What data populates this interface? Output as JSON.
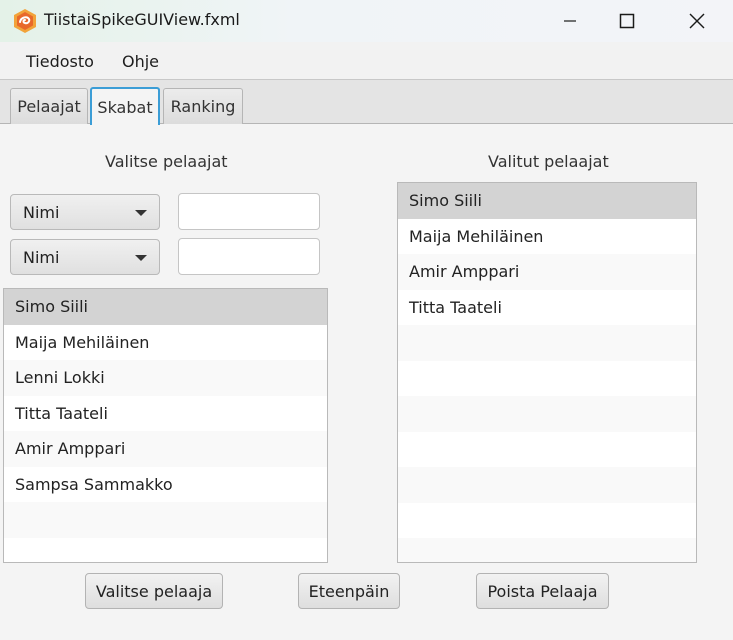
{
  "window": {
    "title": "TiistaiSpikeGUIView.fxml"
  },
  "menu": {
    "items": [
      "Tiedosto",
      "Ohje"
    ]
  },
  "tabs": [
    {
      "label": "Pelaajat",
      "active": false
    },
    {
      "label": "Skabat",
      "active": true
    },
    {
      "label": "Ranking",
      "active": false
    }
  ],
  "left_panel": {
    "title": "Valitse pelaajat",
    "filters": [
      {
        "combo_value": "Nimi",
        "text_value": ""
      },
      {
        "combo_value": "Nimi",
        "text_value": ""
      }
    ],
    "players": [
      "Simo Siili",
      "Maija Mehiläinen",
      "Lenni Lokki",
      "Titta Taateli",
      "Amir Amppari",
      "Sampsa Sammakko"
    ],
    "selected_index": 0
  },
  "right_panel": {
    "title": "Valitut pelaajat",
    "players": [
      "Simo Siili",
      "Maija Mehiläinen",
      "Amir Amppari",
      "Titta Taateli"
    ],
    "selected_index": 0
  },
  "buttons": {
    "select": "Valitse pelaaja",
    "next": "Eteenpäin",
    "remove": "Poista Pelaaja"
  },
  "colors": {
    "accent_tab_border": "#3b9dd6",
    "selected_row": "#d3d3d3"
  }
}
